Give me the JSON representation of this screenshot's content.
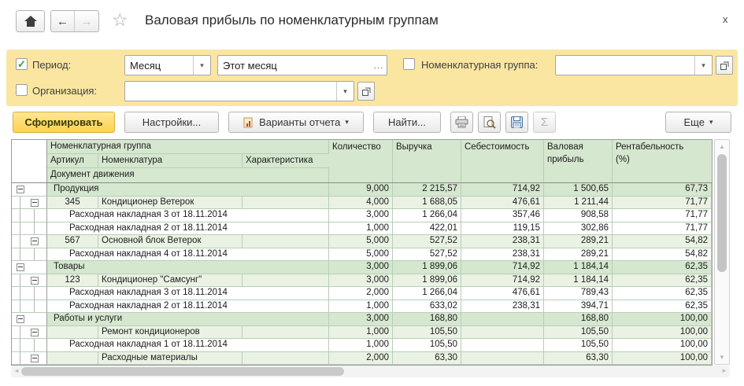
{
  "window": {
    "title": "Валовая прибыль по номенклатурным группам",
    "close_glyph": "x",
    "icons": {
      "home": "home-icon",
      "back": "←",
      "forward": "→",
      "star": "☆",
      "dropdown": "▾",
      "ellipsis": "..."
    }
  },
  "colors": {
    "panel_yellow": "#fae6a1",
    "generate_yellow": "#ffd24e",
    "header_green": "#d6e7cf",
    "group_green": "#eaf2e4",
    "check_green": "#2ea12e"
  },
  "filters": {
    "period": {
      "label": "Период:",
      "checked": true,
      "check_glyph": "✓",
      "unit_value": "Месяц",
      "value": "Этот месяц",
      "more_glyph": "..."
    },
    "organization": {
      "label": "Организация:",
      "checked": false,
      "value": ""
    },
    "nomenclature_group": {
      "label": "Номенклатурная группа:",
      "checked": false,
      "value": ""
    }
  },
  "toolbar": {
    "generate": "Сформировать",
    "settings": "Настройки...",
    "variants": "Варианты отчета",
    "find": "Найти...",
    "sigma": "Σ",
    "more": "Еще"
  },
  "table": {
    "header": {
      "group": "Номенклатурная группа",
      "article": "Артикул",
      "nomenclature": "Номенклатура",
      "characteristic": "Характеристика",
      "doc": "Документ движения",
      "qty": "Количество",
      "revenue": "Выручка",
      "cost": "Себестоимость",
      "gross": "Валовая\nприбыль",
      "margin": "Рентабельность\n(%)"
    },
    "rows": [
      {
        "level": 1,
        "name": "Продукция",
        "qty": "9,000",
        "revenue": "2 215,57",
        "cost": "714,92",
        "gross": "1 500,65",
        "margin": "67,73"
      },
      {
        "level": 2,
        "article": "345",
        "name": "Кондиционер Ветерок",
        "qty": "4,000",
        "revenue": "1 688,05",
        "cost": "476,61",
        "gross": "1 211,44",
        "margin": "71,77"
      },
      {
        "level": 3,
        "name": "Расходная накладная 3 от 18.11.2014",
        "qty": "3,000",
        "revenue": "1 266,04",
        "cost": "357,46",
        "gross": "908,58",
        "margin": "71,77"
      },
      {
        "level": 3,
        "name": "Расходная накладная 2 от 18.11.2014",
        "qty": "1,000",
        "revenue": "422,01",
        "cost": "119,15",
        "gross": "302,86",
        "margin": "71,77"
      },
      {
        "level": 2,
        "article": "567",
        "name": "Основной блок Ветерок",
        "qty": "5,000",
        "revenue": "527,52",
        "cost": "238,31",
        "gross": "289,21",
        "margin": "54,82"
      },
      {
        "level": 3,
        "name": "Расходная накладная 4 от 18.11.2014",
        "qty": "5,000",
        "revenue": "527,52",
        "cost": "238,31",
        "gross": "289,21",
        "margin": "54,82"
      },
      {
        "level": 1,
        "name": "Товары",
        "qty": "3,000",
        "revenue": "1 899,06",
        "cost": "714,92",
        "gross": "1 184,14",
        "margin": "62,35"
      },
      {
        "level": 2,
        "article": "123",
        "name": "Кондиционер \"Самсунг\"",
        "qty": "3,000",
        "revenue": "1 899,06",
        "cost": "714,92",
        "gross": "1 184,14",
        "margin": "62,35"
      },
      {
        "level": 3,
        "name": "Расходная накладная 3 от 18.11.2014",
        "qty": "2,000",
        "revenue": "1 266,04",
        "cost": "476,61",
        "gross": "789,43",
        "margin": "62,35"
      },
      {
        "level": 3,
        "name": "Расходная накладная 2 от 18.11.2014",
        "qty": "1,000",
        "revenue": "633,02",
        "cost": "238,31",
        "gross": "394,71",
        "margin": "62,35"
      },
      {
        "level": 1,
        "name": "Работы и услуги",
        "qty": "3,000",
        "revenue": "168,80",
        "cost": "",
        "gross": "168,80",
        "margin": "100,00"
      },
      {
        "level": 2,
        "article": "",
        "name": "Ремонт кондиционеров",
        "qty": "1,000",
        "revenue": "105,50",
        "cost": "",
        "gross": "105,50",
        "margin": "100,00"
      },
      {
        "level": 3,
        "name": "Расходная накладная 1 от 18.11.2014",
        "qty": "1,000",
        "revenue": "105,50",
        "cost": "",
        "gross": "105,50",
        "margin": "100,00"
      },
      {
        "level": 2,
        "article": "",
        "name": "Расходные материалы",
        "qty": "2,000",
        "revenue": "63,30",
        "cost": "",
        "gross": "63,30",
        "margin": "100,00"
      }
    ]
  }
}
